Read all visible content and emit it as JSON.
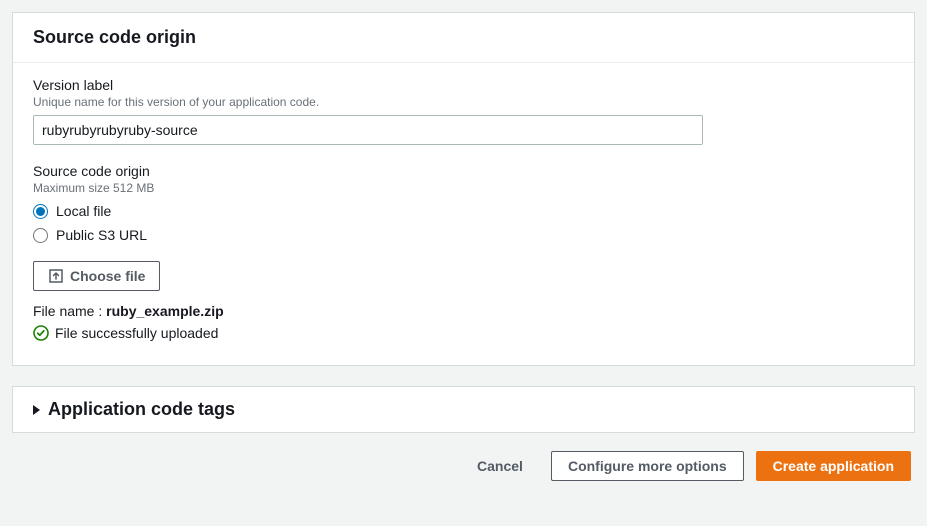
{
  "sourcePanel": {
    "title": "Source code origin",
    "versionLabel": {
      "label": "Version label",
      "help": "Unique name for this version of your application code.",
      "value": "rubyrubyrubyruby-source"
    },
    "originGroup": {
      "label": "Source code origin",
      "help": "Maximum size 512 MB",
      "options": {
        "local": "Local file",
        "s3": "Public S3 URL"
      }
    },
    "chooseFileLabel": "Choose file",
    "fileNamePrefix": "File name : ",
    "fileName": "ruby_example.zip",
    "uploadStatus": "File successfully uploaded"
  },
  "tagsPanel": {
    "title": "Application code tags"
  },
  "footer": {
    "cancel": "Cancel",
    "configure": "Configure more options",
    "create": "Create application"
  }
}
